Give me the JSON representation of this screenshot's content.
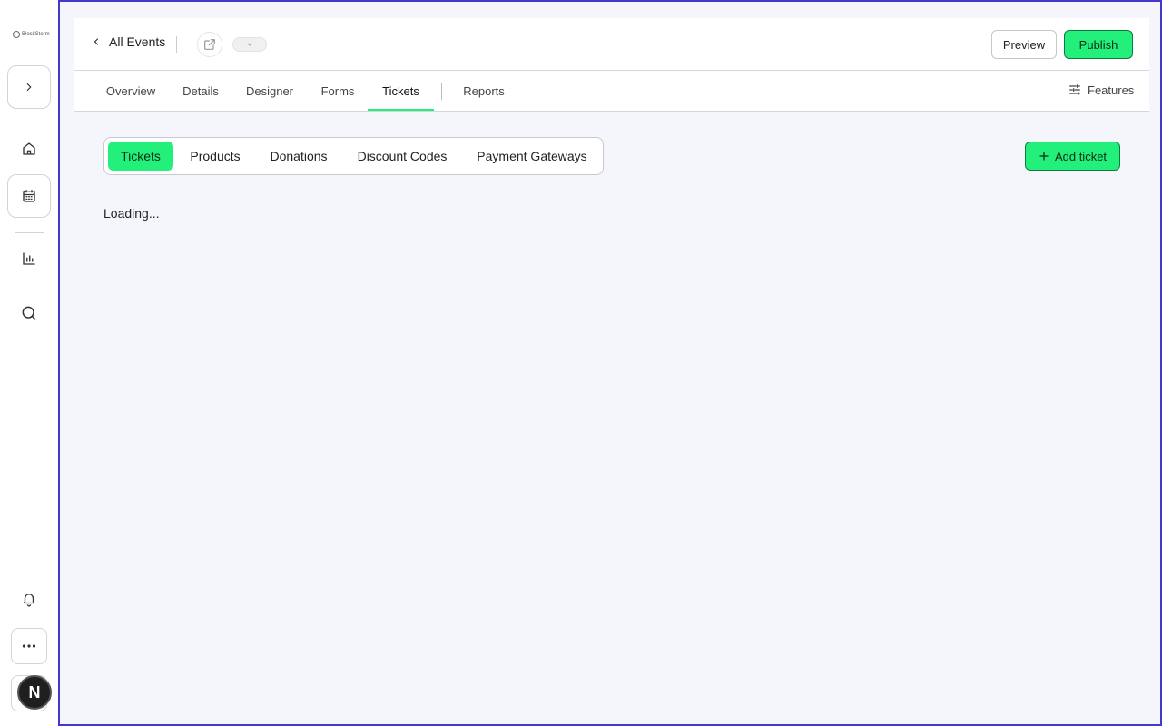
{
  "sidebar": {
    "logo_text": "BlockStorm",
    "items": [
      {
        "name": "expand",
        "icon": "chevron-right-icon"
      },
      {
        "name": "home",
        "icon": "home-icon"
      },
      {
        "name": "calendar",
        "icon": "calendar-icon"
      },
      {
        "name": "analytics",
        "icon": "bar-chart-icon"
      },
      {
        "name": "search",
        "icon": "search-icon"
      },
      {
        "name": "notifications",
        "icon": "bell-icon"
      },
      {
        "name": "more",
        "icon": "more-horizontal-icon"
      }
    ],
    "avatar_letter": "N"
  },
  "header": {
    "back_label": "All Events",
    "preview_label": "Preview",
    "publish_label": "Publish"
  },
  "nav": {
    "tabs": [
      {
        "label": "Overview"
      },
      {
        "label": "Details"
      },
      {
        "label": "Designer"
      },
      {
        "label": "Forms"
      },
      {
        "label": "Tickets",
        "active": true
      },
      {
        "label": "Reports"
      }
    ],
    "features_label": "Features"
  },
  "subtabs": {
    "items": [
      {
        "label": "Tickets",
        "active": true
      },
      {
        "label": "Products"
      },
      {
        "label": "Donations"
      },
      {
        "label": "Discount Codes"
      },
      {
        "label": "Payment Gateways"
      }
    ]
  },
  "actions": {
    "add_ticket_label": "Add ticket"
  },
  "content": {
    "loading_text": "Loading..."
  },
  "colors": {
    "accent": "#22f07a",
    "frame_border": "#4338ca",
    "canvas_bg": "#f5f6fb"
  }
}
